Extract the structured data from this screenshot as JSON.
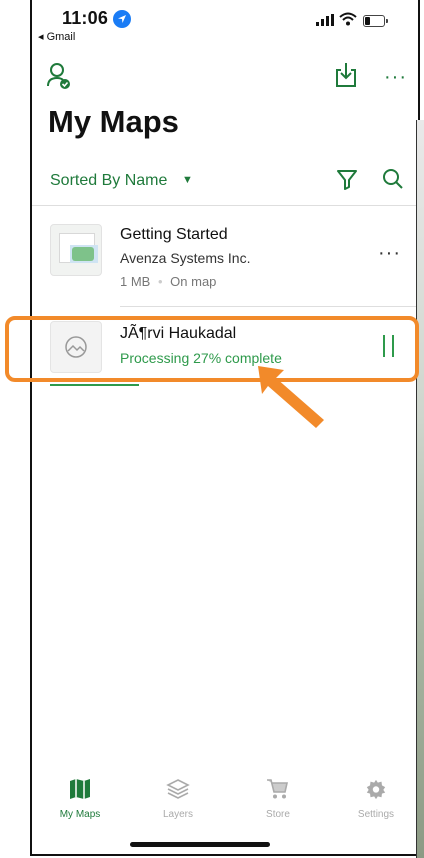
{
  "status_bar": {
    "time": "11:06",
    "back_app": "◂ Gmail"
  },
  "header": {
    "title": "My Maps",
    "profile_icon": "user-check-icon",
    "download_icon": "download-icon",
    "more_label": "···"
  },
  "sort": {
    "label": "Sorted By Name",
    "caret": "▼"
  },
  "maps": [
    {
      "title": "Getting Started",
      "publisher": "Avenza Systems Inc.",
      "size": "1 MB",
      "separator": "•",
      "status": "On map",
      "more_label": "···"
    },
    {
      "title": "JÃ¶rvi Haukadal",
      "status": "Processing 27% complete",
      "progress_fraction": 0.27
    }
  ],
  "tabs": [
    {
      "label": "My Maps",
      "icon": "map-icon",
      "active": true
    },
    {
      "label": "Layers",
      "icon": "layers-icon",
      "active": false
    },
    {
      "label": "Store",
      "icon": "cart-icon",
      "active": false
    },
    {
      "label": "Settings",
      "icon": "gear-icon",
      "active": false
    }
  ],
  "colors": {
    "accent": "#1f7a3b",
    "processing": "#2e9a4b",
    "highlight": "#f28a2a",
    "location": "#1a7cf5"
  }
}
